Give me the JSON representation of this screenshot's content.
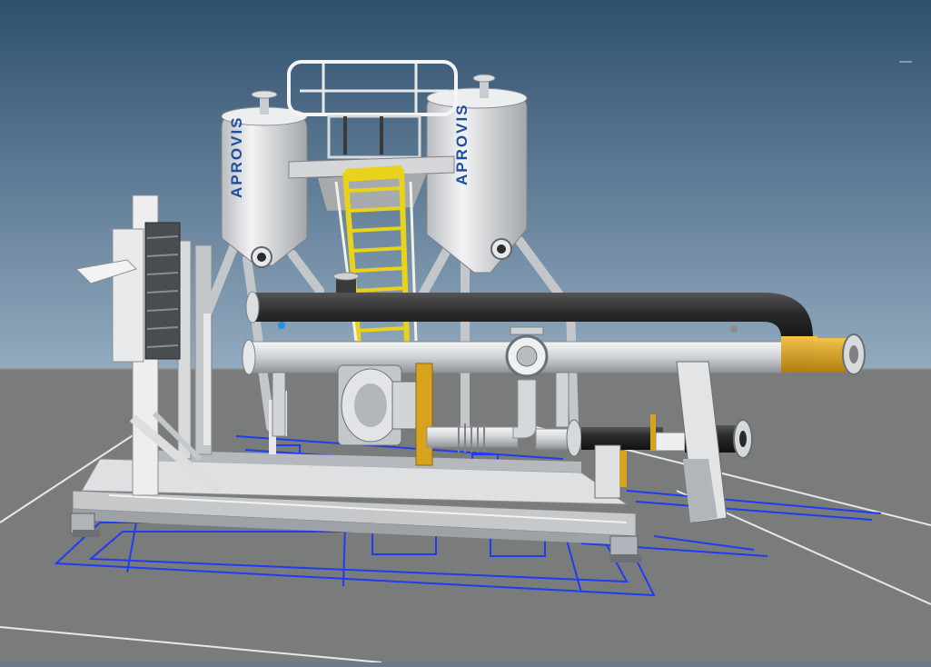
{
  "scene": {
    "tank_left_brand": "APROVIS",
    "tank_right_brand": "APROVIS",
    "colors": {
      "sky_top": "#2f4f6d",
      "sky_bottom": "#8fa7bd",
      "ground": "#7b7d7b",
      "steel": "#d9dadb",
      "steel_dark": "#9a9ea3",
      "insulation_black": "#2b2b2b",
      "safety_yellow": "#e8d21a",
      "copper": "#d8a21e",
      "blueprint_blue": "#1f3df0",
      "brand_blue": "#1f4f9e"
    }
  }
}
